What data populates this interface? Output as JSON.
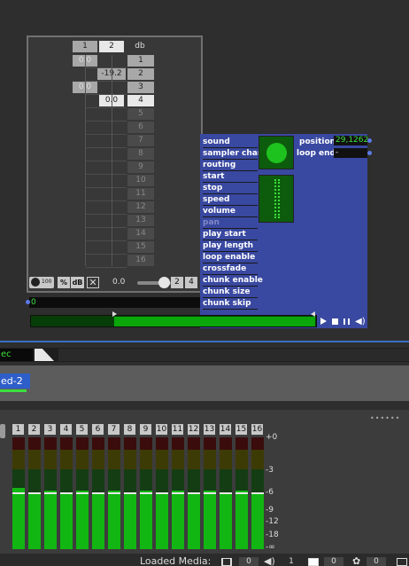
{
  "matrix": {
    "header_cols": [
      "1",
      "2",
      "db"
    ],
    "rows": [
      {
        "label": "1",
        "value": "0.0"
      },
      {
        "label": "2",
        "value": "-19.2"
      },
      {
        "label": "3",
        "value": "0.0"
      },
      {
        "label": "4",
        "value": "0.0"
      },
      {
        "label": "5",
        "value": ""
      },
      {
        "label": "6",
        "value": ""
      },
      {
        "label": "7",
        "value": ""
      },
      {
        "label": "8",
        "value": ""
      },
      {
        "label": "9",
        "value": ""
      },
      {
        "label": "10",
        "value": ""
      },
      {
        "label": "11",
        "value": ""
      },
      {
        "label": "12",
        "value": ""
      },
      {
        "label": "13",
        "value": ""
      },
      {
        "label": "14",
        "value": ""
      },
      {
        "label": "15",
        "value": ""
      },
      {
        "label": "16",
        "value": ""
      }
    ],
    "toolbar": {
      "percent": "%",
      "db": "dB",
      "readout": "0.0",
      "ch2": "2",
      "ch4": "4",
      "scale_label": "100"
    }
  },
  "sampler": {
    "params": [
      "sound",
      "sampler chan",
      "routing",
      "start",
      "stop",
      "speed",
      "volume",
      "pan",
      "play start",
      "play length",
      "loop enable",
      "crossfade",
      "chunk enable",
      "chunk size",
      "chunk skip"
    ],
    "position_label": "position",
    "position_value": "29,1262",
    "loop_end_label": "loop end",
    "loop_end_value": "-",
    "number_box": "0"
  },
  "track": {
    "name_partial": "ec",
    "tab_label": "ed-2"
  },
  "mixer": {
    "channels": [
      "1",
      "2",
      "3",
      "4",
      "5",
      "6",
      "7",
      "8",
      "9",
      "10",
      "11",
      "12",
      "13",
      "14",
      "15",
      "16"
    ],
    "levels": [
      0.55,
      0.5,
      0.52,
      0.5,
      0.52,
      0.5,
      0.52,
      0.5,
      0.52,
      0.5,
      0.52,
      0.5,
      0.52,
      0.5,
      0.52,
      0.5
    ],
    "scale": [
      "+0",
      "-3",
      "-6",
      "-9",
      "-12",
      "-18",
      "-∞"
    ]
  },
  "status": {
    "loaded_media_label": "Loaded Media:",
    "video_count": "0",
    "audio_count": "1",
    "image_count": "0",
    "other_count": "0"
  }
}
